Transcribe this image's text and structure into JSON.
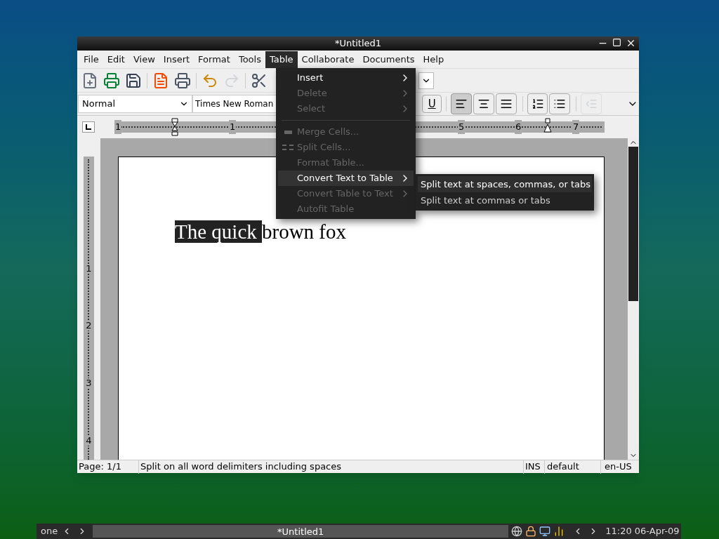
{
  "window": {
    "title": "*Untitled1"
  },
  "menubar": [
    {
      "label": "File",
      "selected": false
    },
    {
      "label": "Edit",
      "selected": false
    },
    {
      "label": "View",
      "selected": false
    },
    {
      "label": "Insert",
      "selected": false
    },
    {
      "label": "Format",
      "selected": false
    },
    {
      "label": "Tools",
      "selected": false
    },
    {
      "label": "Table",
      "selected": true
    },
    {
      "label": "Collaborate",
      "selected": false
    },
    {
      "label": "Documents",
      "selected": false
    },
    {
      "label": "Help",
      "selected": false
    }
  ],
  "toolbar": [
    {
      "kind": "new",
      "disabled": false
    },
    {
      "kind": "print",
      "disabled": false
    },
    {
      "kind": "save",
      "disabled": false
    },
    {
      "kind": "separator"
    },
    {
      "kind": "export-pdf",
      "disabled": false
    },
    {
      "kind": "print-preview",
      "disabled": false
    },
    {
      "kind": "separator"
    },
    {
      "kind": "undo",
      "disabled": false
    },
    {
      "kind": "redo",
      "disabled": true
    },
    {
      "kind": "separator"
    },
    {
      "kind": "cut",
      "disabled": false
    }
  ],
  "format_bar": {
    "style": "Normal",
    "font": "Times New Roman",
    "underline": "U",
    "buttons": [
      {
        "kind": "align-left",
        "selected": true,
        "disabled": false
      },
      {
        "kind": "align-center",
        "selected": false,
        "disabled": false
      },
      {
        "kind": "align-justify",
        "selected": false,
        "disabled": false
      },
      {
        "kind": "numbered-list",
        "selected": false,
        "disabled": false
      },
      {
        "kind": "bullet-list",
        "selected": false,
        "disabled": false
      },
      {
        "kind": "indent",
        "selected": false,
        "disabled": true
      }
    ]
  },
  "ruler": {
    "horizontal": [
      "1",
      "1",
      "5",
      "6",
      "7"
    ],
    "vertical": [
      "1",
      "2",
      "3",
      "4"
    ]
  },
  "document": {
    "runs": [
      {
        "text": "The quick ",
        "selected": true
      },
      {
        "text": "brown fox",
        "selected": false
      }
    ]
  },
  "table_menu": {
    "items": [
      {
        "kind": "item",
        "label": "Insert",
        "disabled": false,
        "submenu": true,
        "selected": false
      },
      {
        "kind": "item",
        "label": "Delete",
        "disabled": true,
        "submenu": true,
        "selected": false
      },
      {
        "kind": "item",
        "label": "Select",
        "disabled": true,
        "submenu": true,
        "selected": false
      },
      {
        "kind": "separator"
      },
      {
        "kind": "merge-cells",
        "label": "Merge Cells...",
        "disabled": true,
        "submenu": false,
        "selected": false
      },
      {
        "kind": "split-cells",
        "label": "Split Cells...",
        "disabled": true,
        "submenu": false,
        "selected": false
      },
      {
        "kind": "item",
        "label": "Format Table...",
        "disabled": true,
        "submenu": false,
        "selected": false
      },
      {
        "kind": "item",
        "label": "Convert Text to Table",
        "disabled": false,
        "submenu": true,
        "selected": true
      },
      {
        "kind": "item",
        "label": "Convert Table to Text",
        "disabled": true,
        "submenu": true,
        "selected": false
      },
      {
        "kind": "item",
        "label": "Autofit Table",
        "disabled": true,
        "submenu": false,
        "selected": false
      }
    ]
  },
  "submenu": {
    "items": [
      {
        "label": "Split text at spaces, commas, or tabs",
        "selected": true
      },
      {
        "label": "Split text at commas or tabs",
        "selected": false
      }
    ]
  },
  "status_bar": {
    "page": "Page: 1/1",
    "message": "Split on all word delimiters including spaces",
    "mode": "INS",
    "style": "default",
    "language": "en-US"
  },
  "taskbar": {
    "desktop": "one",
    "tasks": [
      {
        "label": "*Untitled1",
        "selected": true
      }
    ],
    "clock": "11:20 06-Apr-09"
  }
}
